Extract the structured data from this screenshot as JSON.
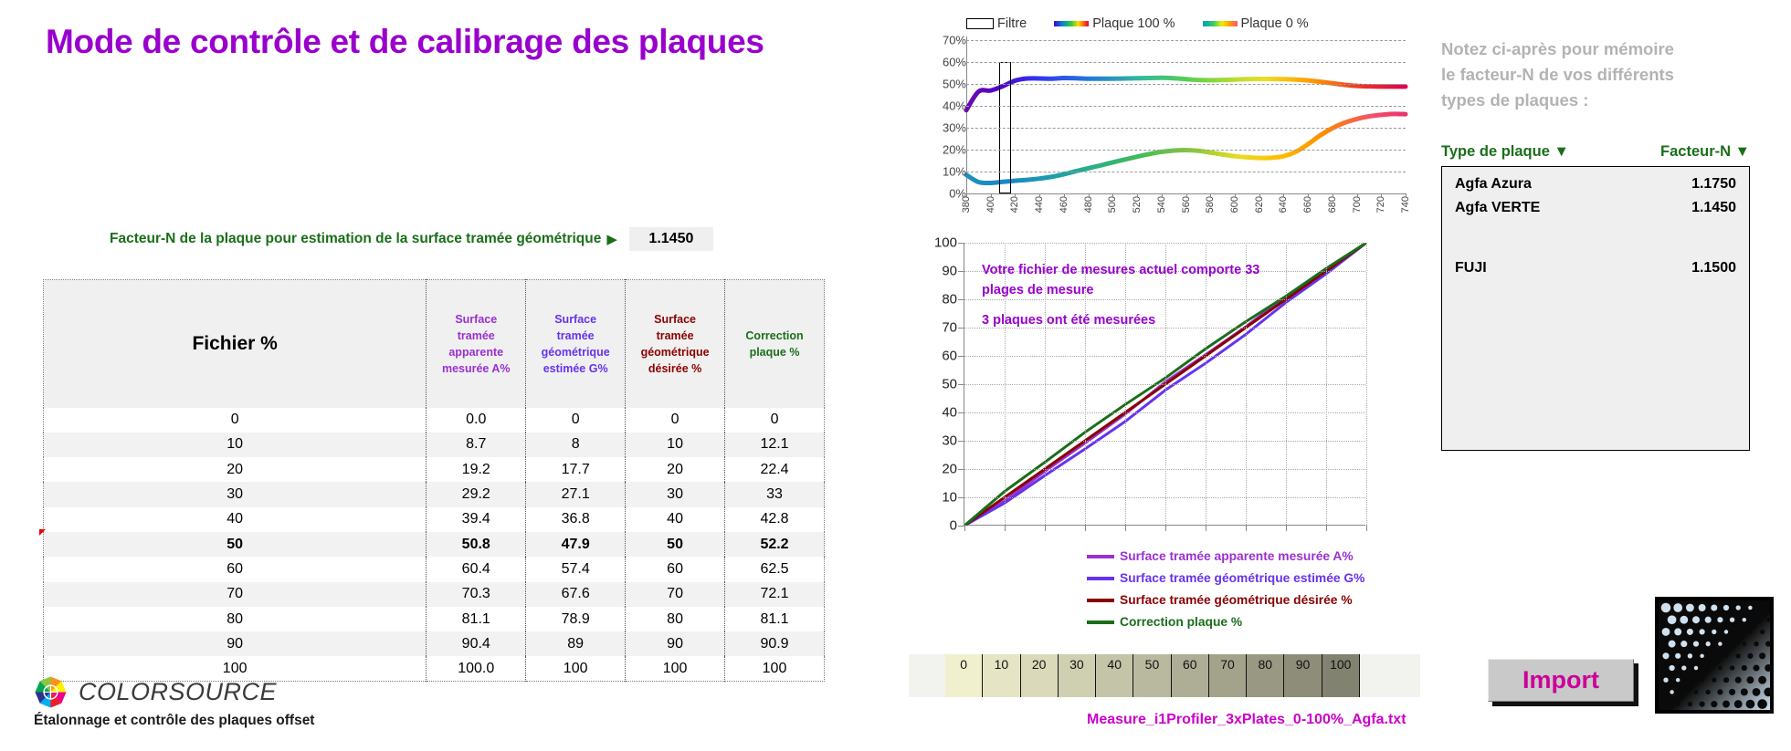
{
  "title": "Mode de contrôle et de calibrage des plaques",
  "factor": {
    "label": "Facteur-N de la plaque pour estimation de la surface tramée géométrique",
    "arrow": "▶",
    "value": "1.1450"
  },
  "table": {
    "headers": [
      "Fichier %",
      "Surface tramée apparente mesurée A%",
      "Surface tramée géométrique estimée G%",
      "Surface tramée géométrique désirée %",
      "Correction plaque %"
    ],
    "header_lines": [
      [
        "Fichier %"
      ],
      [
        "Surface",
        "tramée",
        "apparente",
        "mesurée A%"
      ],
      [
        "Surface",
        "tramée",
        "géométrique",
        "estimée G%"
      ],
      [
        "Surface",
        "tramée",
        "géométrique",
        "désirée %"
      ],
      [
        "Correction",
        "plaque %"
      ]
    ],
    "rows": [
      {
        "fichier": "0",
        "a": "0.0",
        "g": "0",
        "d": "0",
        "c": "0",
        "highlight": false
      },
      {
        "fichier": "10",
        "a": "8.7",
        "g": "8",
        "d": "10",
        "c": "12.1",
        "highlight": false
      },
      {
        "fichier": "20",
        "a": "19.2",
        "g": "17.7",
        "d": "20",
        "c": "22.4",
        "highlight": false
      },
      {
        "fichier": "30",
        "a": "29.2",
        "g": "27.1",
        "d": "30",
        "c": "33",
        "highlight": false
      },
      {
        "fichier": "40",
        "a": "39.4",
        "g": "36.8",
        "d": "40",
        "c": "42.8",
        "highlight": false
      },
      {
        "fichier": "50",
        "a": "50.8",
        "g": "47.9",
        "d": "50",
        "c": "52.2",
        "highlight": true
      },
      {
        "fichier": "60",
        "a": "60.4",
        "g": "57.4",
        "d": "60",
        "c": "62.5",
        "highlight": false
      },
      {
        "fichier": "70",
        "a": "70.3",
        "g": "67.6",
        "d": "70",
        "c": "72.1",
        "highlight": false
      },
      {
        "fichier": "80",
        "a": "81.1",
        "g": "78.9",
        "d": "80",
        "c": "81.1",
        "highlight": false
      },
      {
        "fichier": "90",
        "a": "90.4",
        "g": "89",
        "d": "90",
        "c": "90.9",
        "highlight": false
      },
      {
        "fichier": "100",
        "a": "100.0",
        "g": "100",
        "d": "100",
        "c": "100",
        "highlight": false
      }
    ]
  },
  "logo": {
    "name": "COLORSOURCE",
    "subtitle": "Étalonnage et contrôle des plaques offset"
  },
  "right_panel": {
    "notice_lines": [
      "Notez ci-après pour mémoire",
      "le facteur-N de vos différents",
      "types de plaques :"
    ],
    "col_type": "Type de plaque",
    "col_factor": "Facteur-N",
    "sort_arrow": "▼",
    "plates": [
      {
        "name": "Agfa Azura",
        "factor": "1.1750"
      },
      {
        "name": "Agfa VERTE",
        "factor": "1.1450"
      },
      {
        "name": "FUJI",
        "factor": "1.1500"
      }
    ]
  },
  "import_button": "Import",
  "file_name": "Measure_i1Profiler_3xPlates_0-100%_Agfa.txt",
  "strip": {
    "labels": [
      "0",
      "10",
      "20",
      "30",
      "40",
      "50",
      "60",
      "70",
      "80",
      "90",
      "100"
    ]
  },
  "colors": {
    "title": "#9900CC",
    "green": "#1a6e1a",
    "apparent": "#9B30D0",
    "geometric": "#6633EE",
    "desired": "#8B0000",
    "correction": "#1a6e1a",
    "magenta": "#CC00CC",
    "import_text": "#CC0099",
    "grey_notice": "#b3b3b3"
  },
  "chart_data": [
    {
      "type": "line",
      "name": "spectral-reflectance",
      "title": "",
      "xlabel": "",
      "ylabel": "",
      "xlim": [
        380,
        740
      ],
      "ylim": [
        0,
        70
      ],
      "ytick_labels": [
        "0%",
        "10%",
        "20%",
        "30%",
        "40%",
        "50%",
        "60%",
        "70%"
      ],
      "ytick_values": [
        0,
        10,
        20,
        30,
        40,
        50,
        60,
        70
      ],
      "xtick_labels": [
        "380",
        "400",
        "420",
        "440",
        "460",
        "480",
        "500",
        "520",
        "540",
        "560",
        "580",
        "600",
        "620",
        "640",
        "660",
        "680",
        "700",
        "720",
        "740"
      ],
      "grid": true,
      "legend": [
        "Filtre",
        "Plaque 100 %",
        "Plaque 0 %"
      ],
      "legend_position": "top",
      "annotations": [
        {
          "name": "Filtre",
          "x_range": [
            407,
            417
          ],
          "y_range": [
            0,
            60
          ]
        }
      ],
      "x": [
        380,
        390,
        400,
        410,
        420,
        430,
        440,
        450,
        460,
        470,
        480,
        490,
        500,
        510,
        520,
        530,
        540,
        550,
        560,
        570,
        580,
        590,
        600,
        610,
        620,
        630,
        640,
        650,
        660,
        670,
        680,
        690,
        700,
        710,
        720,
        730,
        740
      ],
      "series": [
        {
          "name": "Plaque 100 %",
          "values": [
            38.0,
            46.5,
            47.0,
            49.0,
            51.5,
            52.5,
            52.5,
            52.4,
            52.7,
            52.6,
            52.4,
            52.4,
            52.4,
            52.5,
            52.6,
            52.7,
            52.8,
            52.6,
            52.2,
            51.8,
            51.7,
            51.8,
            52.0,
            52.2,
            52.3,
            52.3,
            52.2,
            52.0,
            51.6,
            51.0,
            50.3,
            49.6,
            49.1,
            48.9,
            48.8,
            48.8,
            48.8
          ]
        },
        {
          "name": "Plaque 0 %",
          "values": [
            8.5,
            5.2,
            4.8,
            5.3,
            5.8,
            6.2,
            6.8,
            7.6,
            8.8,
            10.2,
            11.5,
            12.8,
            14.2,
            15.5,
            16.8,
            18.0,
            19.0,
            19.6,
            19.8,
            19.5,
            18.7,
            17.8,
            17.0,
            16.5,
            16.2,
            16.3,
            17.0,
            19.0,
            22.5,
            26.5,
            29.8,
            32.3,
            34.0,
            35.2,
            35.9,
            36.3,
            36.2
          ]
        }
      ]
    },
    {
      "type": "line",
      "name": "plate-calibration-curve",
      "title": "",
      "xlabel": "",
      "ylabel": "",
      "xlim": [
        0,
        100
      ],
      "ylim": [
        0,
        100
      ],
      "ytick_labels": [
        "0",
        "10",
        "20",
        "30",
        "40",
        "50",
        "60",
        "70",
        "80",
        "90",
        "100"
      ],
      "xtick_labels": [
        "0",
        "10",
        "20",
        "30",
        "40",
        "50",
        "60",
        "70",
        "80",
        "90",
        "100"
      ],
      "grid": true,
      "legend_position": "inside-bottom-right",
      "annotations": [
        "Votre fichier de mesures actuel comporte 33 plages de mesure",
        "3 plaques ont été mesurées"
      ],
      "x": [
        0,
        10,
        20,
        30,
        40,
        50,
        60,
        70,
        80,
        90,
        100
      ],
      "series": [
        {
          "name": "Surface tramée apparente mesurée A%",
          "color": "#9B30D0",
          "values": [
            0,
            8.7,
            19.2,
            29.2,
            39.4,
            50.8,
            60.4,
            70.3,
            81.1,
            90.4,
            100.0
          ]
        },
        {
          "name": "Surface tramée géométrique estimée G%",
          "color": "#6633EE",
          "values": [
            0,
            8,
            17.7,
            27.1,
            36.8,
            47.9,
            57.4,
            67.6,
            78.9,
            89,
            100
          ]
        },
        {
          "name": "Surface tramée géométrique désirée %",
          "color": "#8B0000",
          "values": [
            0,
            10,
            20,
            30,
            40,
            50,
            60,
            70,
            80,
            90,
            100
          ]
        },
        {
          "name": "Correction plaque %",
          "color": "#1a6e1a",
          "values": [
            0,
            12.1,
            22.4,
            33,
            42.8,
            52.2,
            62.5,
            72.1,
            81.1,
            90.9,
            100
          ]
        }
      ]
    }
  ]
}
